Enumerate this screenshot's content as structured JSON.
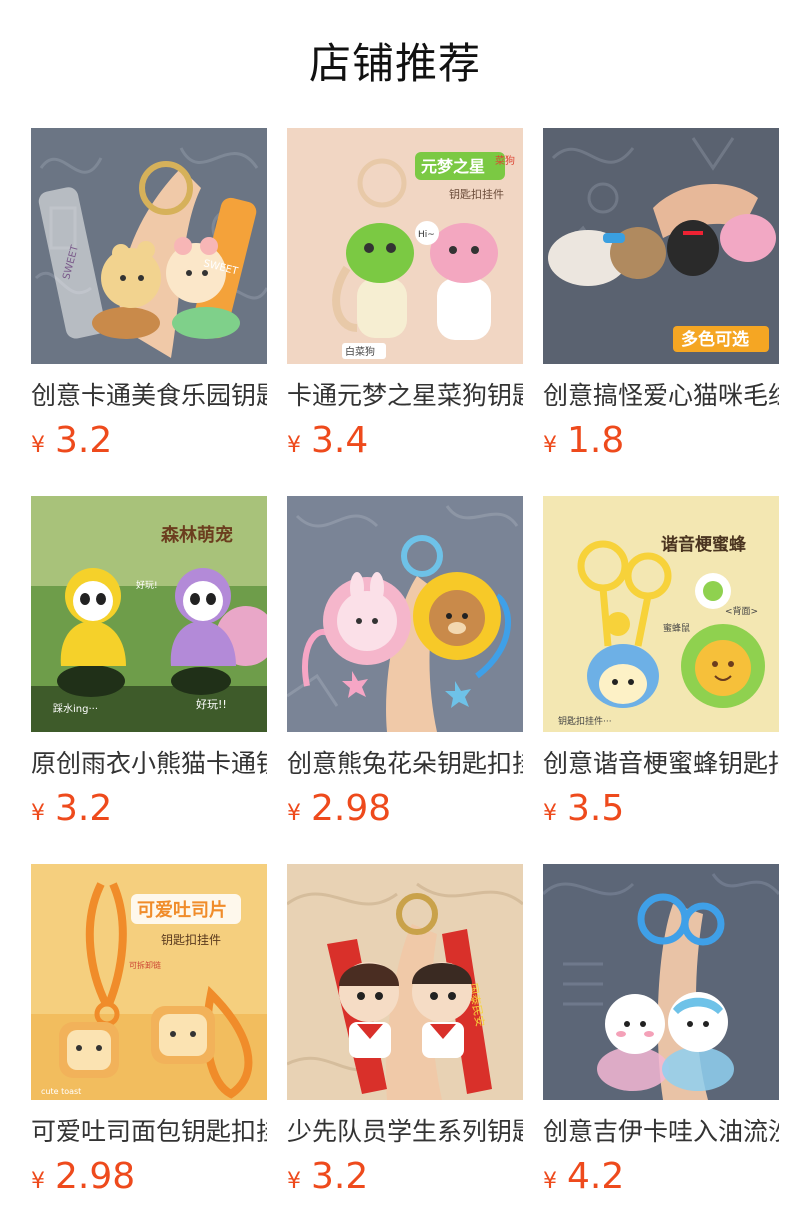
{
  "section_title": "店铺推荐",
  "currency": "¥",
  "products": [
    {
      "name": "创意卡通美食乐园钥匙扣",
      "price": "3.2",
      "image_text": [
        "SWEET",
        "SWEET"
      ],
      "bg": "#6b7584",
      "accent": "#f0b84a"
    },
    {
      "name": "卡通元梦之星菜狗钥匙扣",
      "price": "3.4",
      "image_text": [
        "元梦之星",
        "菜狗",
        "钥匙扣挂件",
        "白菜狗",
        "Hi~"
      ],
      "bg": "#f1d6c3",
      "accent": "#7bc943"
    },
    {
      "name": "创意搞怪爱心猫咪毛绒钥匙扣",
      "price": "1.8",
      "image_text": [
        "多色可选"
      ],
      "bg": "#5a6270",
      "accent": "#f2a8c4"
    },
    {
      "name": "原创雨衣小熊猫卡通钥匙扣",
      "price": "3.2",
      "image_text": [
        "森林萌宠",
        "好玩!",
        "踩水ing···",
        "好玩!!"
      ],
      "bg": "#6e9d4a",
      "accent": "#f7d730"
    },
    {
      "name": "创意熊兔花朵钥匙扣挂件",
      "price": "2.98",
      "image_text": [],
      "bg": "#7a8496",
      "accent": "#f7c928"
    },
    {
      "name": "创意谐音梗蜜蜂钥匙扣挂件",
      "price": "3.5",
      "image_text": [
        "谐音梗蜜蜂",
        "钥匙扣挂件···",
        "<背面>",
        "蜜蜂鼠"
      ],
      "bg": "#f3e7b2",
      "accent": "#f7d23a"
    },
    {
      "name": "可爱吐司面包钥匙扣挂件",
      "price": "2.98",
      "image_text": [
        "可爱吐司片",
        "钥匙扣挂件",
        "可拆卸链",
        "cute toast"
      ],
      "bg": "#f5cf7e",
      "accent": "#f08c2a"
    },
    {
      "name": "少先队员学生系列钥匙扣",
      "price": "3.2",
      "image_text": [
        "国泰民安"
      ],
      "bg": "#e8d2b4",
      "accent": "#d9302a"
    },
    {
      "name": "创意吉伊卡哇入油流沙钥匙扣",
      "price": "4.2",
      "image_text": [],
      "bg": "#5c6677",
      "accent": "#3fa0e8"
    }
  ]
}
